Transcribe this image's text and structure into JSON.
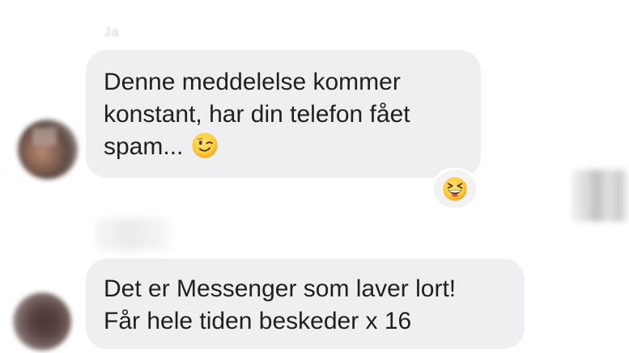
{
  "conversation": {
    "sender_name_blurred": "Ja",
    "messages": [
      {
        "text": "Denne meddelelse kommer konstant, har din telefon fået spam...",
        "line1": "Denne meddelelse kommer",
        "line2": "konstant, har din telefon fået",
        "line3": "spam...",
        "inline_emoji": "winking-face-emoji",
        "reaction_emoji": "grinning-squinting-face-emoji"
      },
      {
        "text": "Det er Messenger som laver lort! Får hele tiden beskeder x 16",
        "line1": "Det er Messenger som laver lort!",
        "line2": "Får hele tiden beskeder x 16"
      }
    ]
  },
  "colors": {
    "bubble_background": "#efeff1",
    "message_text": "#1f1f21",
    "page_background": "#ffffff"
  }
}
